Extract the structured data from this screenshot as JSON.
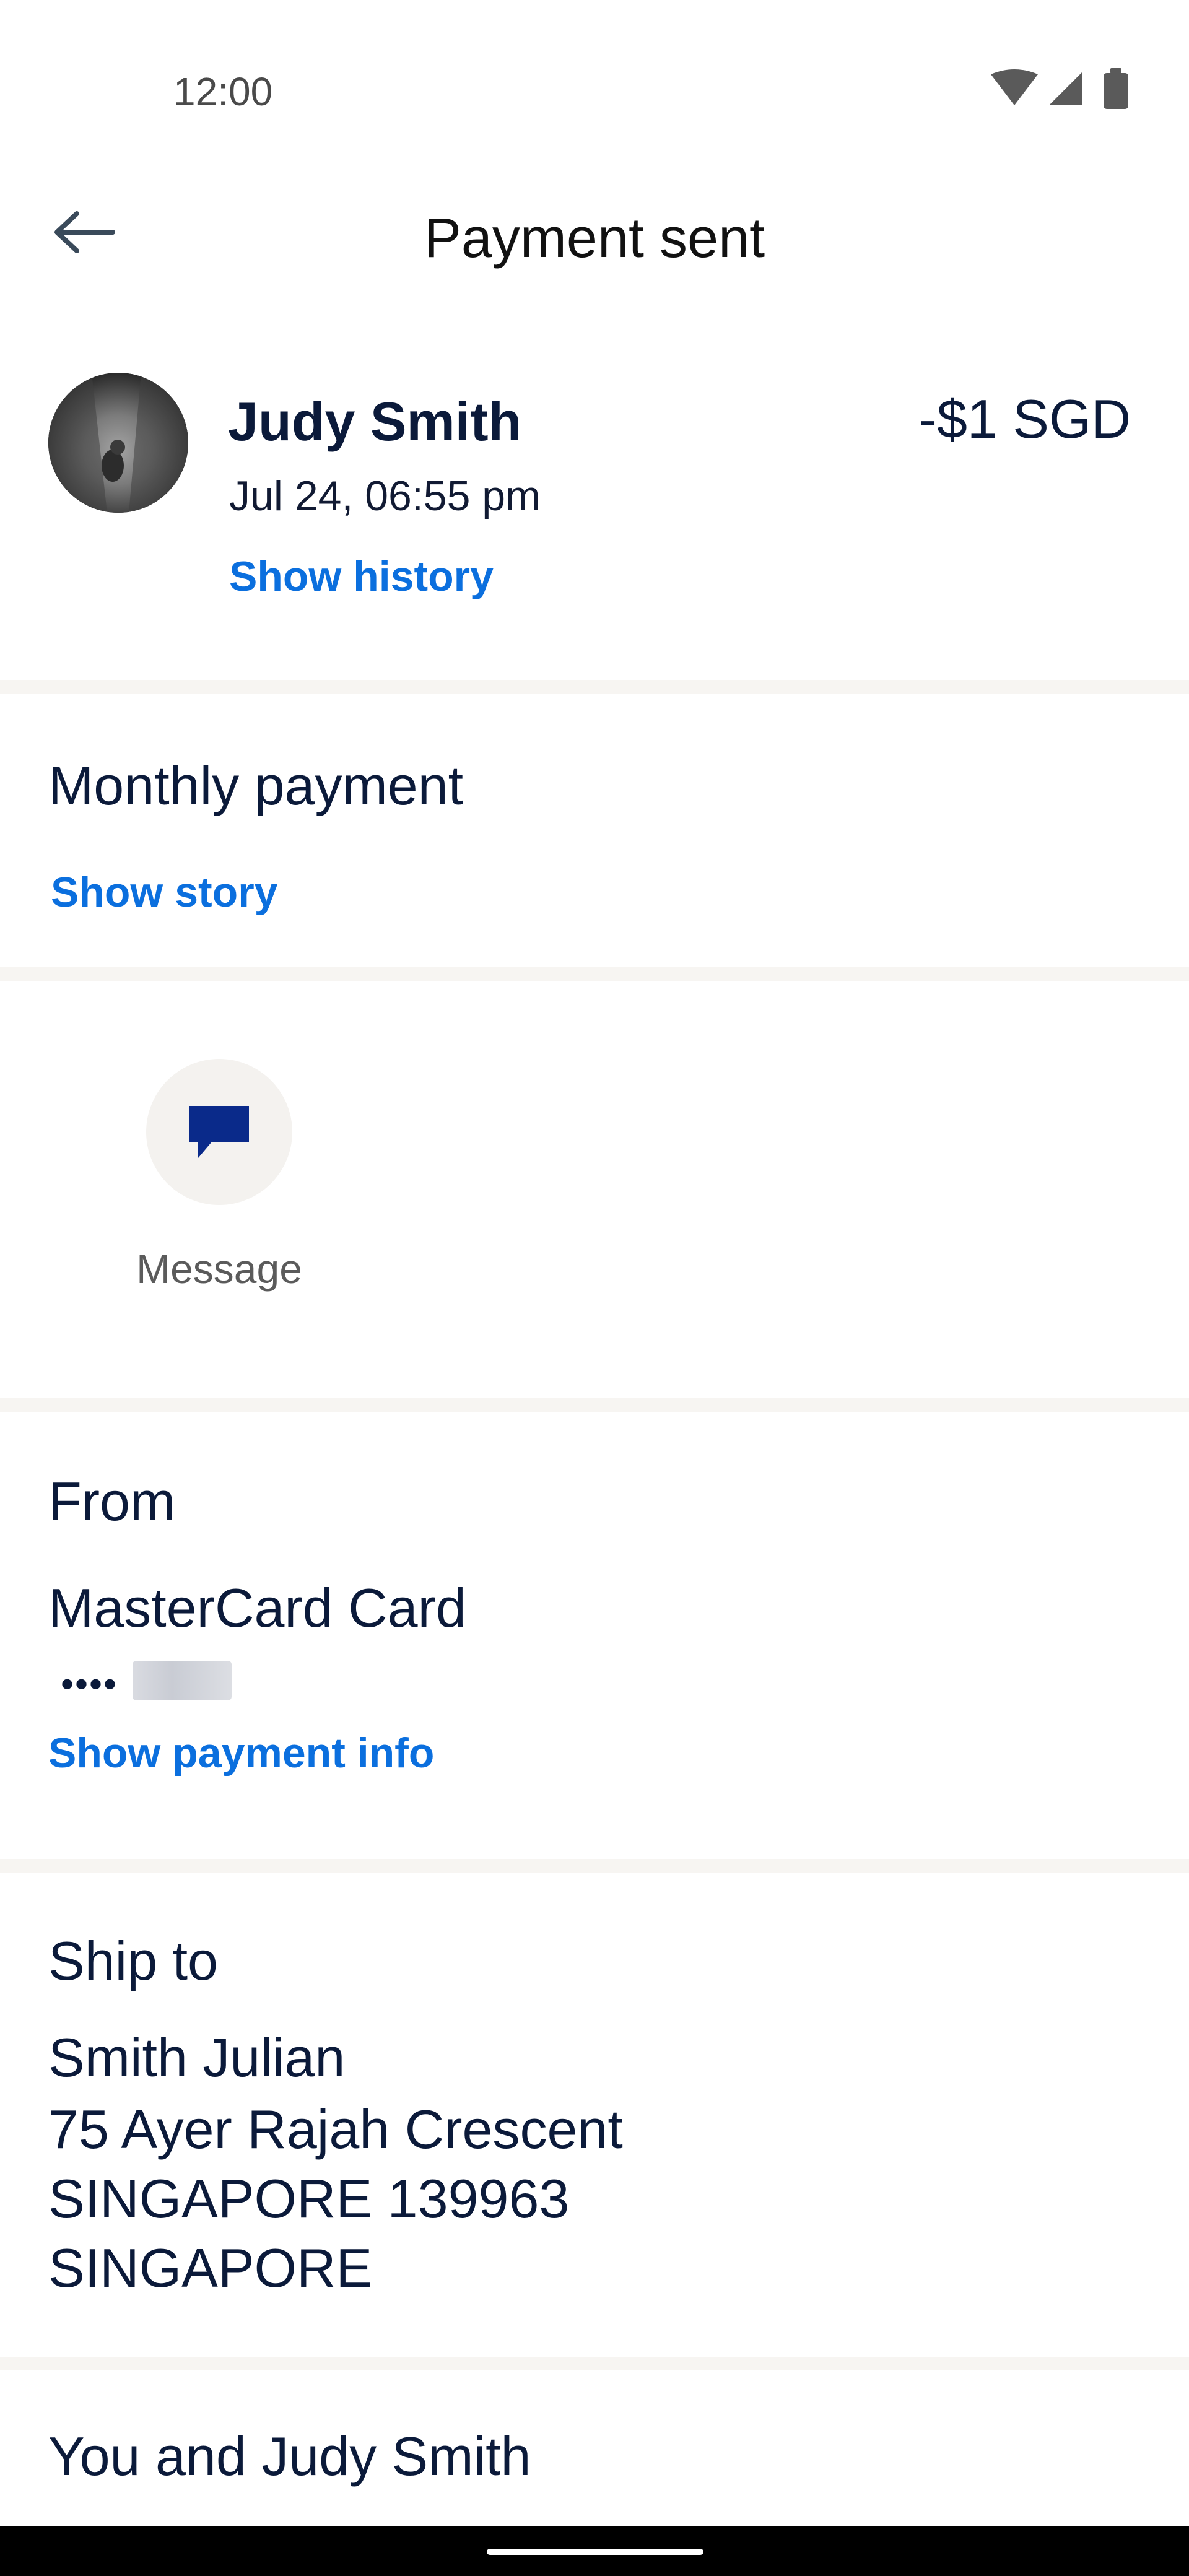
{
  "status_bar": {
    "time": "12:00",
    "icons": [
      "wifi-icon",
      "cell-signal-icon",
      "battery-icon"
    ]
  },
  "header": {
    "back_icon": "arrow-left-icon",
    "title": "Payment sent"
  },
  "summary": {
    "name": "Judy Smith",
    "amount": "-$1 SGD",
    "date": "Jul 24, 06:55 pm",
    "show_history_label": "Show history"
  },
  "note": {
    "text": "Monthly payment",
    "show_story_label": "Show story"
  },
  "actions": {
    "message_icon": "message-icon",
    "message_label": "Message"
  },
  "from": {
    "label": "From",
    "card_name": "MasterCard Card",
    "card_mask": "••••",
    "show_payment_info_label": "Show payment info"
  },
  "ship_to": {
    "label": "Ship to",
    "address_lines": [
      "Smith Julian",
      "75 Ayer Rajah Crescent",
      "SINGAPORE 139963",
      "SINGAPORE"
    ]
  },
  "footer": {
    "section_title": "You and Judy Smith"
  },
  "colors": {
    "link": "#0b6fde",
    "text_primary": "#0b1a3a",
    "message_icon": "#0a2a8a",
    "divider": "#f7f5f2"
  }
}
